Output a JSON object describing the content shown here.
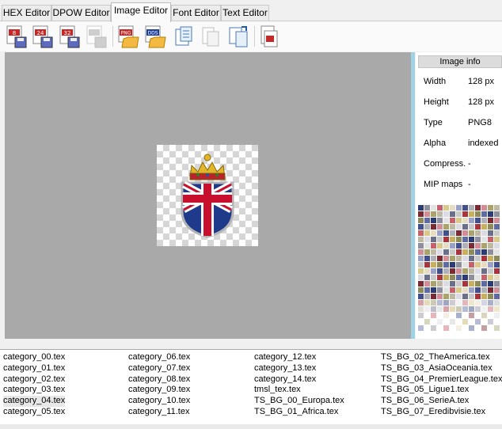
{
  "tabs": [
    {
      "label": "HEX Editor",
      "active": false
    },
    {
      "label": "DPOW Editor",
      "active": false
    },
    {
      "label": "Image Editor",
      "active": true
    },
    {
      "label": "Font Editor",
      "active": false
    },
    {
      "label": "Text Editor",
      "active": false
    }
  ],
  "toolbar": {
    "buttons": [
      {
        "name": "export-8bit-icon",
        "badge": "8"
      },
      {
        "name": "export-24bit-icon",
        "badge": "24"
      },
      {
        "name": "export-32bit-icon",
        "badge": "32"
      },
      {
        "name": "export-disabled-icon",
        "badge": ""
      },
      {
        "name": "import-png-icon",
        "badge": "PNG"
      },
      {
        "name": "import-dds-icon",
        "badge": "DDS"
      },
      {
        "name": "copy-icon",
        "badge": ""
      },
      {
        "name": "paste-icon",
        "badge": ""
      },
      {
        "name": "replace-icon",
        "badge": ""
      },
      {
        "name": "export-pdf-icon",
        "badge": ""
      }
    ]
  },
  "info": {
    "title": "Image info",
    "rows": [
      {
        "key": "Width",
        "value": "128 px"
      },
      {
        "key": "Height",
        "value": "128 px"
      },
      {
        "key": "Type",
        "value": "PNG8"
      },
      {
        "key": "Alpha",
        "value": "indexed"
      },
      {
        "key": "Compress.",
        "value": "-"
      },
      {
        "key": "MIP maps",
        "value": "-"
      }
    ]
  },
  "files": {
    "columns": [
      [
        "category_00.tex",
        "category_01.tex",
        "category_02.tex",
        "category_03.tex",
        "category_04.tex",
        "category_05.tex"
      ],
      [
        "category_06.tex",
        "category_07.tex",
        "category_08.tex",
        "category_09.tex",
        "category_10.tex",
        "category_11.tex"
      ],
      [
        "category_12.tex",
        "category_13.tex",
        "category_14.tex",
        "tmsl_tex.tex",
        "TS_BG_00_Europa.tex",
        "TS_BG_01_Africa.tex"
      ],
      [
        "TS_BG_02_TheAmerica.tex",
        "TS_BG_03_AsiaOceania.tex",
        "TS_BG_04_PremierLeague.tex",
        "TS_BG_05_Ligue1.tex",
        "TS_BG_06_SerieA.tex",
        "TS_BG_07_Eredibvisie.tex"
      ]
    ],
    "selected": "category_04.tex"
  },
  "colors": {
    "canvas": "#a9a9a9",
    "accent": "#9fd3e4",
    "flag_blue": "#1f3a8a",
    "flag_red": "#c8102e"
  }
}
